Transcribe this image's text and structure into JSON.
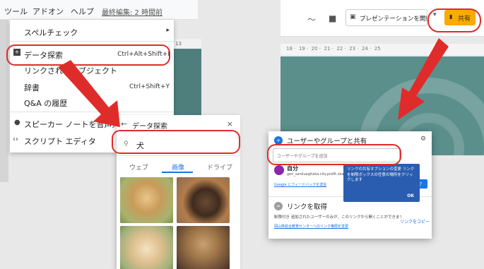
{
  "left": {
    "menubar": {
      "items": [
        "ツール",
        "アドオン",
        "ヘルプ"
      ],
      "last_edit": "最終編集: 2 時間前"
    },
    "ruler_text": "13",
    "tools_menu": {
      "items": [
        {
          "label": "スペルチェック",
          "shortcut": ""
        },
        {
          "label": "データ探索",
          "shortcut": "Ctrl+Alt+Shift+I"
        },
        {
          "label": "リンクされたオブジェクト",
          "shortcut": ""
        },
        {
          "label": "辞書",
          "shortcut": "Ctrl+Shift+Y"
        },
        {
          "label": "Q&A の履歴",
          "shortcut": ""
        },
        {
          "label": "スピーカー ノートを音声入力",
          "shortcut": ""
        },
        {
          "label": "スクリプト エディタ",
          "shortcut": ""
        }
      ]
    },
    "explore": {
      "title": "データ探索",
      "query": "犬",
      "tabs": [
        "ウェブ",
        "画像",
        "ドライブ"
      ],
      "active_tab_color": "#1a73e8"
    }
  },
  "right": {
    "present_label": "プレゼンテーションを開始",
    "share_label": "共有",
    "share_color": "#f9ab00",
    "ruler_ticks": [
      "18",
      "19",
      "20",
      "21",
      "22",
      "23",
      "24",
      "25"
    ],
    "share_dialog": {
      "title": "ユーザーやグループと共有",
      "input_placeholder": "ユーザーやグループを追加",
      "user_name": "自分",
      "user_email": "gen_sankuagitaka.city.profit.okayama.jp",
      "feedback_link": "Google にフィードバックを送信",
      "done_label": "完了",
      "tooltip_text": "リンクの共有オプションの変更 リンクを制限ボックスの任意の場所をクリックします",
      "tooltip_ok": "OK",
      "link_title": "リンクを取得",
      "link_desc": "制限付き 追加されたユーザーのみが、このリンクから開くことができます",
      "link_help": "岡山県総合教育センターへのリンク権限を変更",
      "copy_link": "リンクをコピー"
    }
  }
}
